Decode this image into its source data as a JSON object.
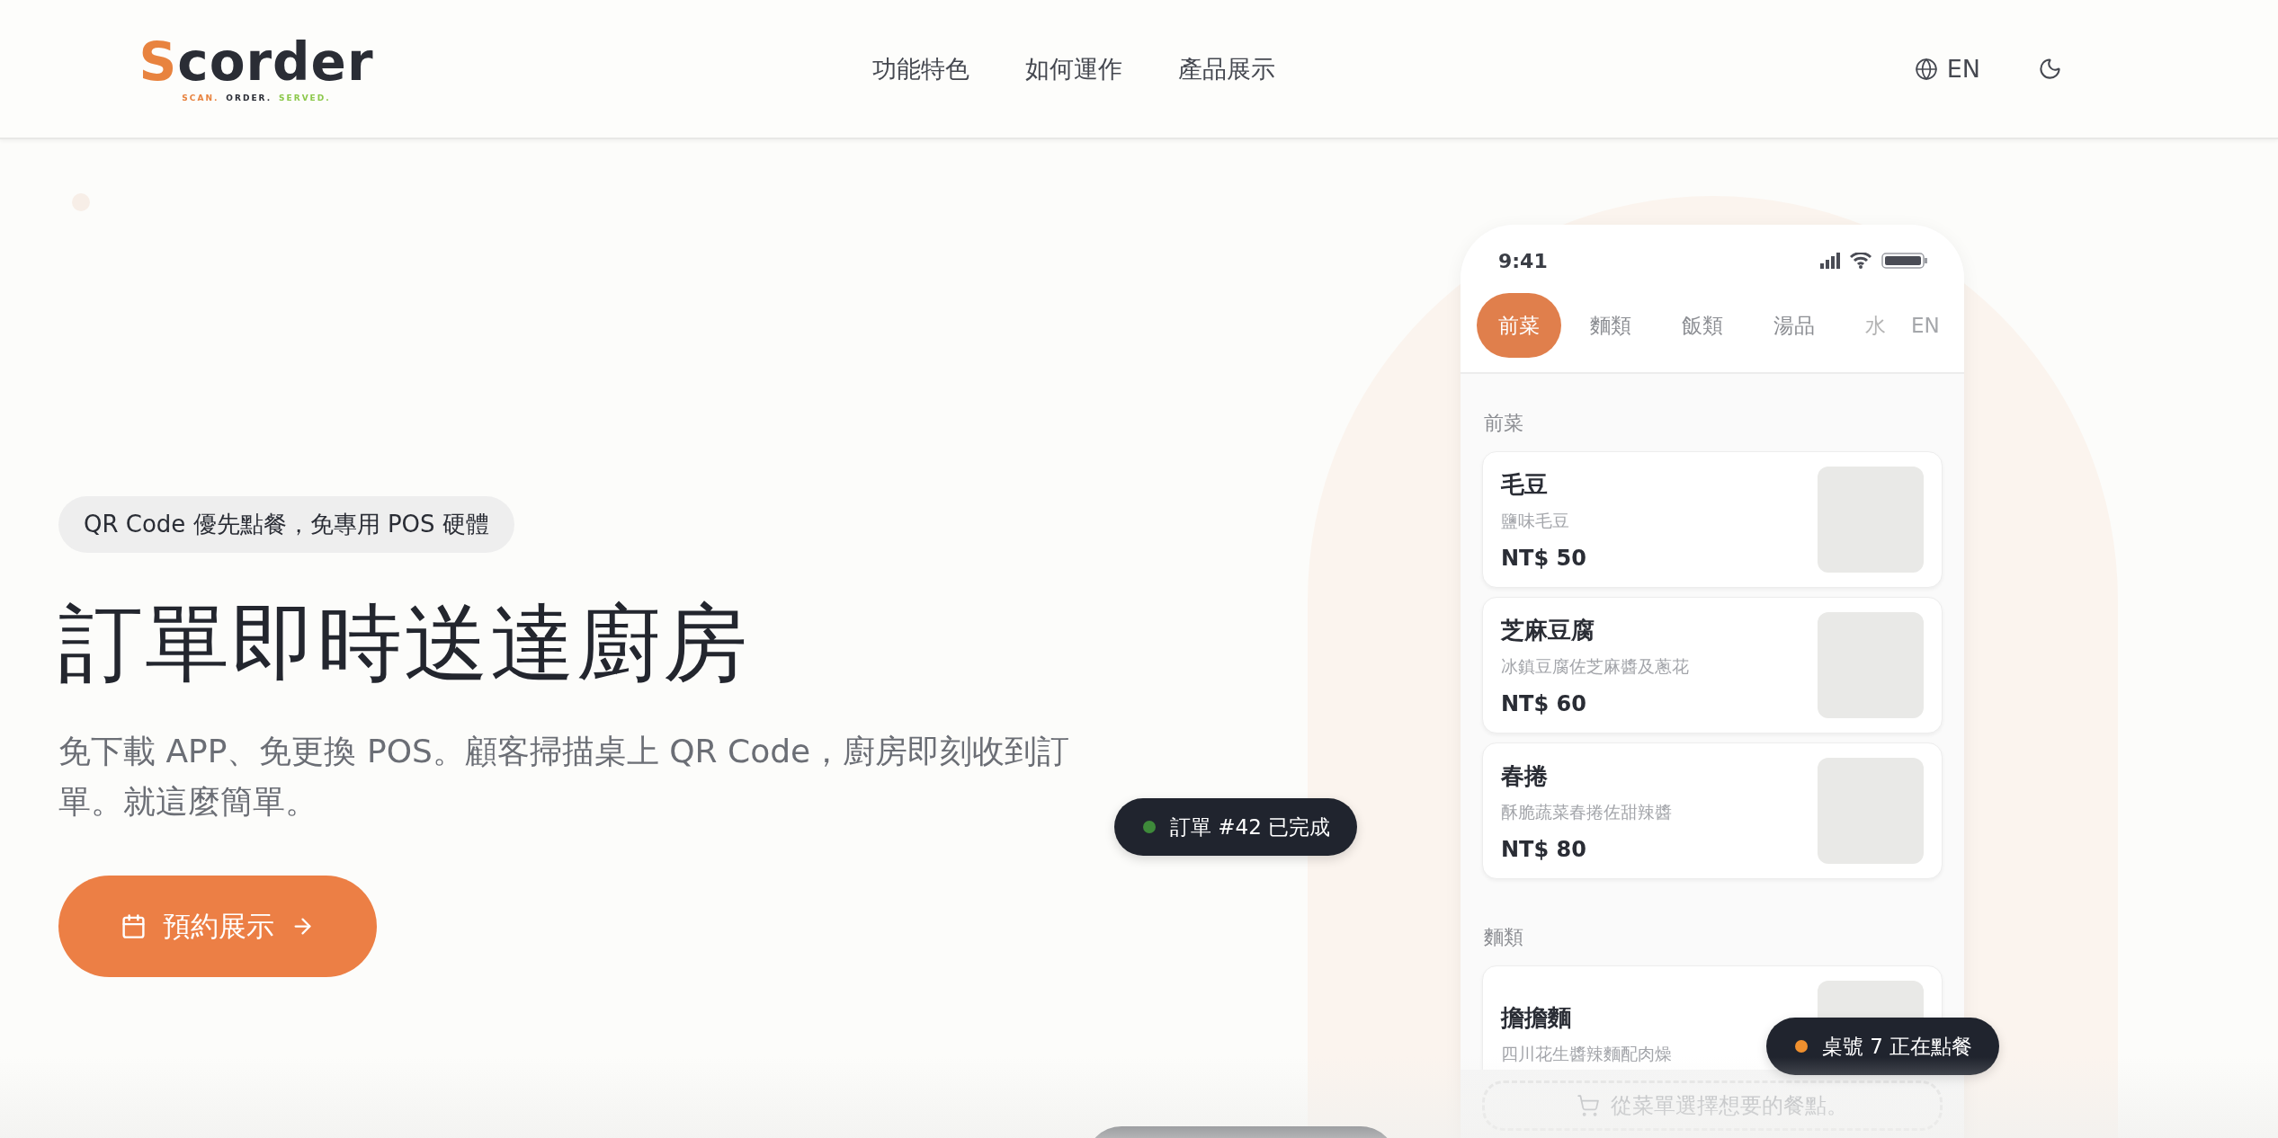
{
  "header": {
    "logo": {
      "mark": "S",
      "text": "corder",
      "tagline": [
        {
          "text": "SCAN.",
          "color": "#e8833f"
        },
        {
          "text": "ORDER.",
          "color": "#2a2d35"
        },
        {
          "text": "SERVED.",
          "color": "#8cc84b"
        }
      ]
    },
    "nav": [
      "功能特色",
      "如何運作",
      "產品展示"
    ],
    "language": "EN"
  },
  "hero": {
    "badge": "QR Code 優先點餐，免專用 POS 硬體",
    "title": "訂單即時送達廚房",
    "description": "免下載 APP、免更換 POS。顧客掃描桌上 QR Code，廚房即刻收到訂單。就這麼簡單。",
    "cta": "預約展示"
  },
  "phone": {
    "time": "9:41",
    "tabs": [
      {
        "label": "前菜",
        "selected": true
      },
      {
        "label": "麵類",
        "selected": false
      },
      {
        "label": "飯類",
        "selected": false
      },
      {
        "label": "湯品",
        "selected": false
      },
      {
        "label": "水",
        "selected": false
      }
    ],
    "language": "EN",
    "sections": [
      {
        "title": "前菜",
        "items": [
          {
            "name": "毛豆",
            "desc": "鹽味毛豆",
            "price": "NT$ 50"
          },
          {
            "name": "芝麻豆腐",
            "desc": "冰鎮豆腐佐芝麻醬及蔥花",
            "price": "NT$ 60"
          },
          {
            "name": "春捲",
            "desc": "酥脆蔬菜春捲佐甜辣醬",
            "price": "NT$ 80"
          }
        ]
      },
      {
        "title": "麵類",
        "items": [
          {
            "name": "擔擔麵",
            "desc": "四川花生醬辣麵配肉燥"
          }
        ]
      }
    ],
    "cart_hint": "從菜單選擇想要的餐點。"
  },
  "toasts": [
    {
      "text": "訂單 #42 已完成",
      "color": "#3e8a3a"
    },
    {
      "text": "桌號 7 正在點餐",
      "color": "#f0902e"
    }
  ]
}
